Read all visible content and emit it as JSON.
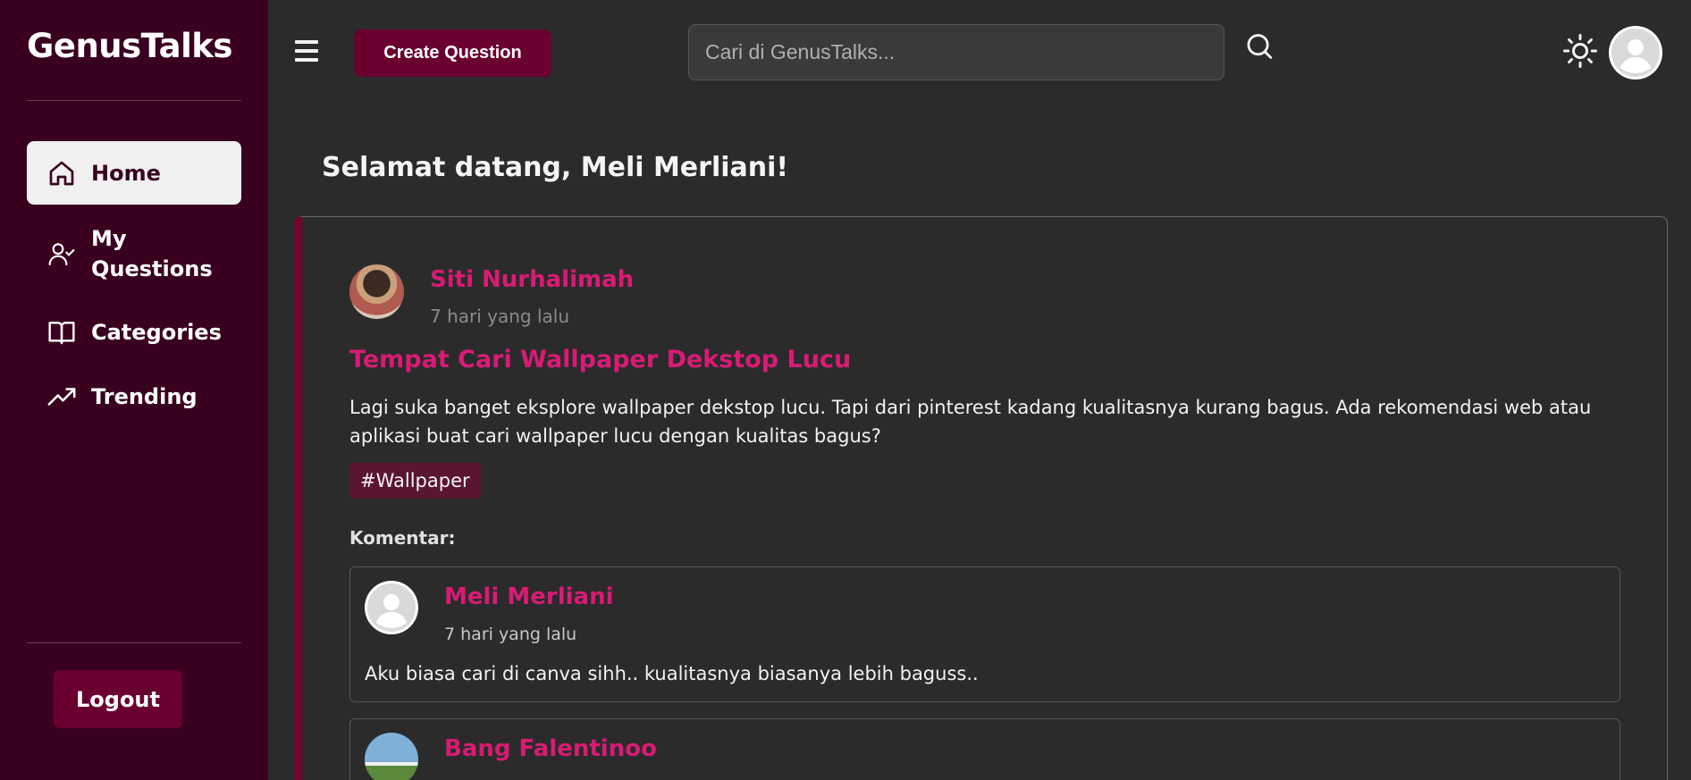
{
  "brand": "GenusTalks",
  "sidebar": {
    "items": [
      {
        "label": "Home",
        "icon": "home-icon",
        "active": true
      },
      {
        "label": "My Questions",
        "icon": "user-check-icon",
        "active": false
      },
      {
        "label": "Categories",
        "icon": "book-open-icon",
        "active": false
      },
      {
        "label": "Trending",
        "icon": "trending-up-icon",
        "active": false
      }
    ],
    "logout_label": "Logout"
  },
  "header": {
    "create_label": "Create Question",
    "search_placeholder": "Cari di GenusTalks..."
  },
  "main": {
    "welcome": "Selamat datang, Meli Merliani!",
    "post": {
      "author": "Siti Nurhalimah",
      "time": "7 hari yang lalu",
      "title": "Tempat Cari Wallpaper Dekstop Lucu",
      "body": "Lagi suka banget eksplore wallpaper dekstop lucu. Tapi dari pinterest kadang kualitasnya kurang bagus. Ada rekomendasi web atau aplikasi buat cari wallpaper lucu dengan kualitas bagus?",
      "tag": "#Wallpaper",
      "comments_label": "Komentar:",
      "comments": [
        {
          "author": "Meli Merliani",
          "time": "7 hari yang lalu",
          "text": "Aku biasa cari di canva sihh.. kualitasnya biasanya lebih baguss.."
        },
        {
          "author": "Bang Falentinoo",
          "time": "",
          "text": ""
        }
      ]
    }
  },
  "colors": {
    "sidebar_bg": "#3a0020",
    "accent": "#d81b74",
    "button_bg": "#6a0030",
    "page_bg": "#2b2b2b"
  }
}
